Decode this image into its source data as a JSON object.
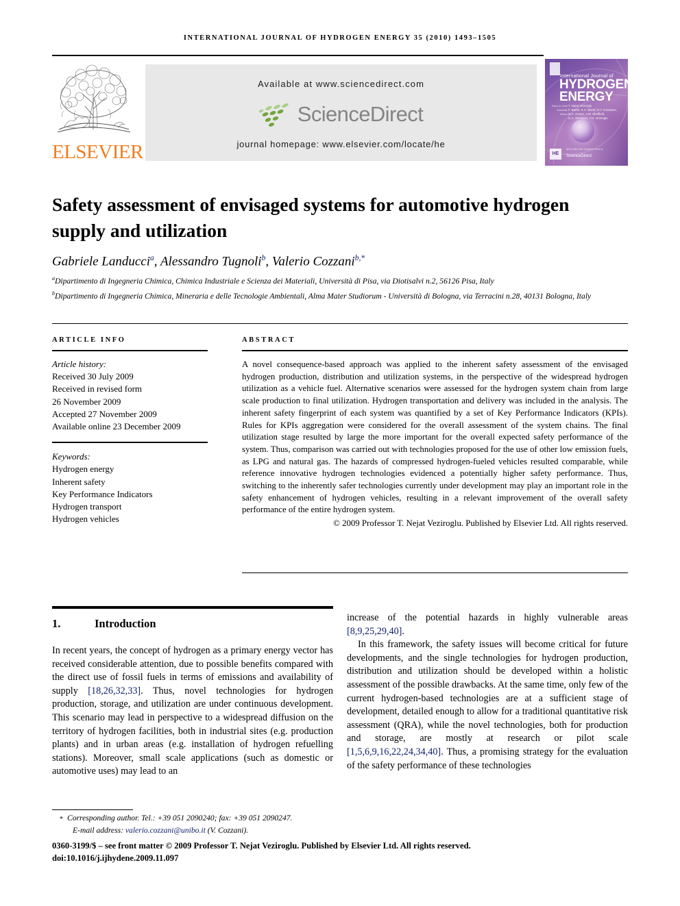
{
  "running_head": "INTERNATIONAL JOURNAL OF HYDROGEN ENERGY 35 (2010) 1493–1505",
  "masthead": {
    "publisher_name": "ELSEVIER",
    "available_at": "Available at www.sciencedirect.com",
    "sciencedirect_wordmark": "ScienceDirect",
    "journal_homepage": "journal homepage: www.elsevier.com/locate/he",
    "cover": {
      "top_line": "International Journal of",
      "title_line1": "HYDROGEN",
      "title_line2": "ENERGY",
      "editors_label": "Editor-in-Chief\nAssociate Editors",
      "editors": "T. Nejat Veziroglu\nF. Barbir, S.A. Sherif, D.Y. Goswami,\nM.A. Rosen, J.W. Sheffield,\nG.A. Skarlatos, T.N. Veziroglu",
      "issn_line": "ISSN 0360-3199  Available online at",
      "hz_badge": "HE",
      "sciencedirect_label": "ScienceDirect"
    },
    "accent_orange": "#f07d20",
    "accent_green": "#6fa63a",
    "banner_bg": "#e8e8e8"
  },
  "title": "Safety assessment of envisaged systems for automotive hydrogen supply and utilization",
  "authors": [
    {
      "name": "Gabriele Landucci",
      "sup": "a"
    },
    {
      "name": "Alessandro Tugnoli",
      "sup": "b"
    },
    {
      "name": "Valerio Cozzani",
      "sup": "b,*"
    }
  ],
  "affiliations": [
    {
      "marker": "a",
      "text": "Dipartimento di Ingegneria Chimica, Chimica Industriale e Scienza dei Materiali, Università di Pisa, via Diotisalvi n.2, 56126 Pisa, Italy"
    },
    {
      "marker": "b",
      "text": "Dipartimento di Ingegneria Chimica, Mineraria e delle Tecnologie Ambientali, Alma Mater Studiorum - Università di Bologna, via Terracini n.28, 40131 Bologna, Italy"
    }
  ],
  "article_info": {
    "heading": "ARTICLE INFO",
    "history_label": "Article history:",
    "history": [
      "Received 30 July 2009",
      "Received in revised form",
      "26 November 2009",
      "Accepted 27 November 2009",
      "Available online 23 December 2009"
    ],
    "keywords_label": "Keywords:",
    "keywords": [
      "Hydrogen energy",
      "Inherent safety",
      "Key Performance Indicators",
      "Hydrogen transport",
      "Hydrogen vehicles"
    ]
  },
  "abstract": {
    "heading": "ABSTRACT",
    "text": "A novel consequence-based approach was applied to the inherent safety assessment of the envisaged hydrogen production, distribution and utilization systems, in the perspective of the widespread hydrogen utilization as a vehicle fuel. Alternative scenarios were assessed for the hydrogen system chain from large scale production to final utilization. Hydrogen transportation and delivery was included in the analysis. The inherent safety fingerprint of each system was quantified by a set of Key Performance Indicators (KPIs). Rules for KPIs aggregation were considered for the overall assessment of the system chains. The final utilization stage resulted by large the more important for the overall expected safety performance of the system. Thus, comparison was carried out with technologies proposed for the use of other low emission fuels, as LPG and natural gas. The hazards of compressed hydrogen-fueled vehicles resulted comparable, while reference innovative hydrogen technologies evidenced a potentially higher safety performance. Thus, switching to the inherently safer technologies currently under development may play an important role in the safety enhancement of hydrogen vehicles, resulting in a relevant improvement of the overall safety performance of the entire hydrogen system.",
    "copyright": "© 2009 Professor T. Nejat Veziroglu. Published by Elsevier Ltd. All rights reserved."
  },
  "body": {
    "section_number": "1.",
    "section_title": "Introduction",
    "left_paragraph_1_a": "In recent years, the concept of hydrogen as a primary energy vector has received considerable attention, due to possible benefits compared with the direct use of fossil fuels in terms of emissions and availability of supply ",
    "left_ref_1": "[18,26,32,33]",
    "left_paragraph_1_b": ". Thus, novel technologies for hydrogen production, storage, and utilization are under continuous development. This scenario may lead in perspective to a widespread diffusion on the territory of hydrogen facilities, both in industrial sites (e.g. production plants) and in urban areas (e.g. installation of hydrogen refuelling stations). Moreover, small scale applications (such as domestic or automotive uses) may lead to an",
    "right_paragraph_1_cont": "increase of the potential hazards in highly vulnerable areas ",
    "right_ref_1": "[8,9,25,29,40]",
    "right_paragraph_1_end": ".",
    "right_paragraph_2_a": "In this framework, the safety issues will become critical for future developments, and the single technologies for hydrogen production, distribution and utilization should be developed within a holistic assessment of the possible drawbacks. At the same time, only few of the current hydrogen-based technologies are at a sufficient stage of development, detailed enough to allow for a traditional quantitative risk assessment (QRA), while the novel technologies, both for production and storage, are mostly at research or pilot scale ",
    "right_ref_2": "[1,5,6,9,16,22,24,34,40]",
    "right_paragraph_2_b": ". Thus, a promising strategy for the evaluation of the safety performance of these technologies"
  },
  "footer": {
    "corresponding_marker": "*",
    "corresponding": "Corresponding author. Tel.: +39 051 2090240; fax: +39 051 2090247.",
    "email_label": "E-mail address:",
    "email": "valerio.cozzani@unibo.it",
    "email_owner": "(V. Cozzani).",
    "imprint": "0360-3199/$ – see front matter © 2009 Professor T. Nejat Veziroglu. Published by Elsevier Ltd. All rights reserved.",
    "doi": "doi:10.1016/j.ijhydene.2009.11.097"
  },
  "colors": {
    "link": "#11216b",
    "elsevier_orange": "#f07d20",
    "sciencedirect_green": "#6fa63a",
    "sciencedirect_grey": "#848484"
  }
}
